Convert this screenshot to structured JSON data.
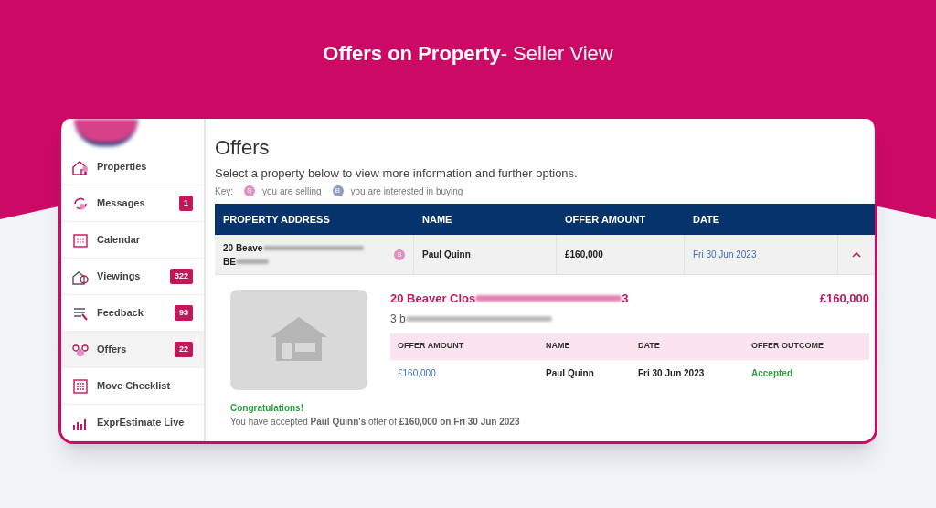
{
  "banner": {
    "title": "Offers on Property",
    "suffix": "- Seller View"
  },
  "sidebar": {
    "items": [
      {
        "label": "Properties",
        "kind": "properties",
        "selected": false
      },
      {
        "label": "Messages",
        "kind": "messages",
        "badge": "1",
        "selected": false
      },
      {
        "label": "Calendar",
        "kind": "calendar",
        "selected": false
      },
      {
        "label": "Viewings",
        "kind": "viewings",
        "badge": "322",
        "selected": false
      },
      {
        "label": "Feedback",
        "kind": "feedback",
        "badge": "93",
        "selected": false
      },
      {
        "label": "Offers",
        "kind": "offers",
        "badge": "22",
        "selected": true
      },
      {
        "label": "Move Checklist",
        "kind": "checklist",
        "selected": false
      },
      {
        "label": "ExprEstimate Live",
        "kind": "chart",
        "selected": false
      }
    ]
  },
  "page": {
    "heading": "Offers",
    "intro": "Select a property below to view more information and further options.",
    "key": {
      "label": "Key:",
      "items": [
        {
          "letter": "S",
          "text": "you are selling",
          "color": "#e58cc0"
        },
        {
          "letter": "B",
          "text": "you are interested in buying",
          "color": "#8e9bbd"
        }
      ]
    }
  },
  "table": {
    "columns": [
      "PROPERTY ADDRESS",
      "NAME",
      "OFFER AMOUNT",
      "DATE"
    ],
    "rows": [
      {
        "address_line1": "20 Beave",
        "address_line2": "BE",
        "role": {
          "letter": "S",
          "color": "#e58cc0"
        },
        "name": "Paul Quinn",
        "amount": "£160,000",
        "date": "Fri 30 Jun 2023",
        "expanded": true,
        "detail": {
          "title": "20 Beaver Clos",
          "title_end": "3",
          "subtitle": "3 b",
          "price": "£160,000",
          "columns": [
            "OFFER AMOUNT",
            "NAME",
            "DATE",
            "OFFER OUTCOME"
          ],
          "offers": [
            {
              "amount": "£160,000",
              "name": "Paul Quinn",
              "date": "Fri 30 Jun 2023",
              "outcome": "Accepted"
            }
          ],
          "message": {
            "heading": "Congratulations!",
            "text": "You have accepted **Paul Quinn's** offer of **£160,000 on Fri 30 Jun 2023**"
          }
        }
      }
    ]
  }
}
